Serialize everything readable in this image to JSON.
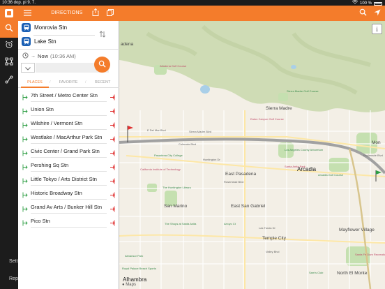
{
  "status": {
    "time": "10:36 dop.",
    "date": "pi 9. 7."
  },
  "rail": {
    "bottom_items": [
      {
        "label": "Sett"
      },
      {
        "label": "Repo"
      }
    ]
  },
  "panel": {
    "title": "DIRECTIONS",
    "origin": "Monrovia Stn",
    "destination": "Lake Stn",
    "time_label": "Now",
    "time_detail": "(10:36 AM)",
    "tabs": [
      {
        "label": "PLACES",
        "active": true
      },
      {
        "label": "FAVORITE",
        "active": false
      },
      {
        "label": "RECENT",
        "active": false
      }
    ],
    "places": [
      {
        "label": "7th Street / Metro Center Stn"
      },
      {
        "label": "Union Stn"
      },
      {
        "label": "Wilshire / Vermont Stn"
      },
      {
        "label": "Westlake / MacArthur Park Stn"
      },
      {
        "label": "Civic Center / Grand Park Stn"
      },
      {
        "label": "Pershing Sq Stn"
      },
      {
        "label": "Little Tokyo / Arts District Stn"
      },
      {
        "label": "Historic Broadway Stn"
      },
      {
        "label": "Grand Av Arts / Bunker Hill Stn"
      },
      {
        "label": "Pico Stn"
      }
    ]
  },
  "map": {
    "labels": [
      {
        "text": "adena",
        "cls": ""
      },
      {
        "text": "Sierra Madre",
        "cls": ""
      },
      {
        "text": "Arcadia",
        "cls": "big"
      },
      {
        "text": "East Pasadena",
        "cls": ""
      },
      {
        "text": "San Marino",
        "cls": ""
      },
      {
        "text": "East San Gabriel",
        "cls": ""
      },
      {
        "text": "Temple City",
        "cls": ""
      },
      {
        "text": "Mayflower Village",
        "cls": ""
      },
      {
        "text": "North El Monte",
        "cls": ""
      },
      {
        "text": "Alhambra",
        "cls": "big"
      },
      {
        "text": "Mon",
        "cls": ""
      },
      {
        "text": "Pasadena City College",
        "cls": "poi"
      },
      {
        "text": "California Institute of Technology",
        "cls": "poi"
      },
      {
        "text": "The Huntington Library",
        "cls": "poi"
      },
      {
        "text": "Los Angeles County Arboretum",
        "cls": "poi"
      },
      {
        "text": "Santa Anita Park",
        "cls": "poi"
      },
      {
        "text": "Arcadia Golf Course",
        "cls": "poi"
      },
      {
        "text": "The Shops at Santa Anita",
        "cls": "poi"
      },
      {
        "text": "Santa Fe Dam Recreation Area",
        "cls": "poi"
      },
      {
        "text": "Almansor Park",
        "cls": "poi"
      },
      {
        "text": "Sierra Madre Golf Course",
        "cls": "poi"
      },
      {
        "text": "Eaton Canyon Golf Course",
        "cls": "poi"
      },
      {
        "text": "Royal Palace Beach Sports",
        "cls": "poi"
      },
      {
        "text": "Sam's Club",
        "cls": "poi"
      },
      {
        "text": "Altadena Golf Course",
        "cls": "poi"
      },
      {
        "text": "Arroyo Ct",
        "cls": "poi"
      },
      {
        "text": "E Del Mar Blvd",
        "cls": "small"
      },
      {
        "text": "Sierra Madre Blvd",
        "cls": "small"
      },
      {
        "text": "Colorado Blvd",
        "cls": "small"
      },
      {
        "text": "Huntington Dr",
        "cls": "small"
      },
      {
        "text": "Rosemead Blvd",
        "cls": "small"
      },
      {
        "text": "Las Tunas Dr",
        "cls": "small"
      },
      {
        "text": "Valley Blvd",
        "cls": "small"
      },
      {
        "text": "Esplanade Blvd",
        "cls": "small"
      }
    ],
    "attribution": "Maps"
  },
  "colors": {
    "accent": "#f47c2b",
    "rail": "#1c1c1c",
    "transit_badge": "#1a5fb4",
    "green": "#2e9e44"
  }
}
